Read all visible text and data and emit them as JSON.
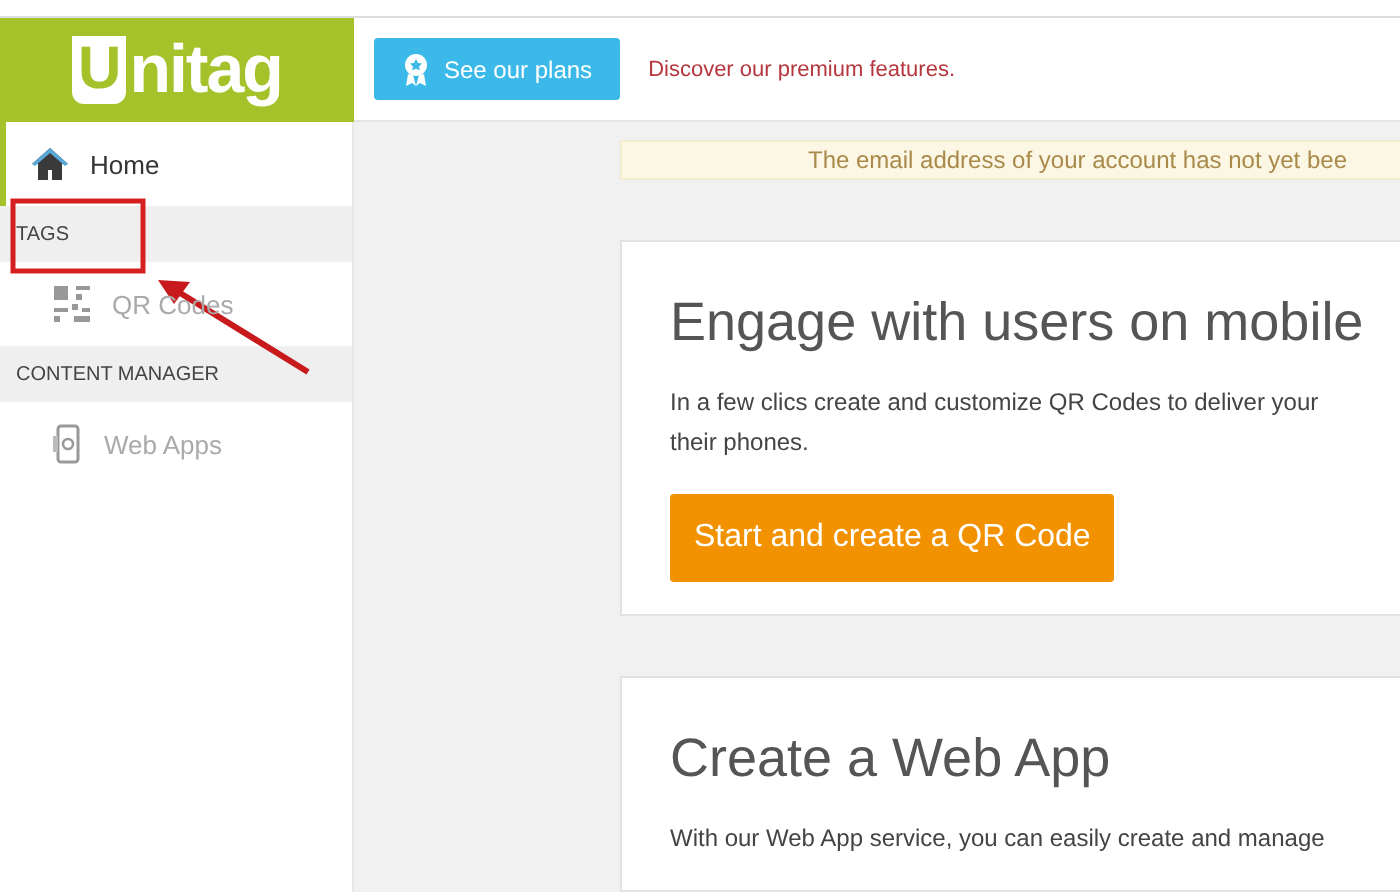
{
  "logo": {
    "text": "nitag",
    "initial": "U"
  },
  "topbar": {
    "plans_button": "See our plans",
    "promo": "Discover our premium features."
  },
  "sidebar": {
    "items": [
      {
        "kind": "home",
        "label": "Home",
        "selected": true
      },
      {
        "kind": "header",
        "label": "TAGS"
      },
      {
        "kind": "qr",
        "label": "QR Codes",
        "selected": false
      },
      {
        "kind": "header",
        "label": "CONTENT MANAGER"
      },
      {
        "kind": "phone",
        "label": "Web Apps",
        "selected": false
      }
    ]
  },
  "notice": "The email address of your account has not yet bee",
  "cards": [
    {
      "title": "Engage with users on mobile",
      "text_lines": [
        "In a few clics create and customize QR Codes to deliver your",
        "their phones."
      ],
      "button": "Start and create a QR Code"
    },
    {
      "title": "Create a Web App",
      "text_lines": [
        "With our Web App service, you can easily create and manage"
      ]
    }
  ],
  "annotation": {
    "kind": "box-and-arrow"
  }
}
